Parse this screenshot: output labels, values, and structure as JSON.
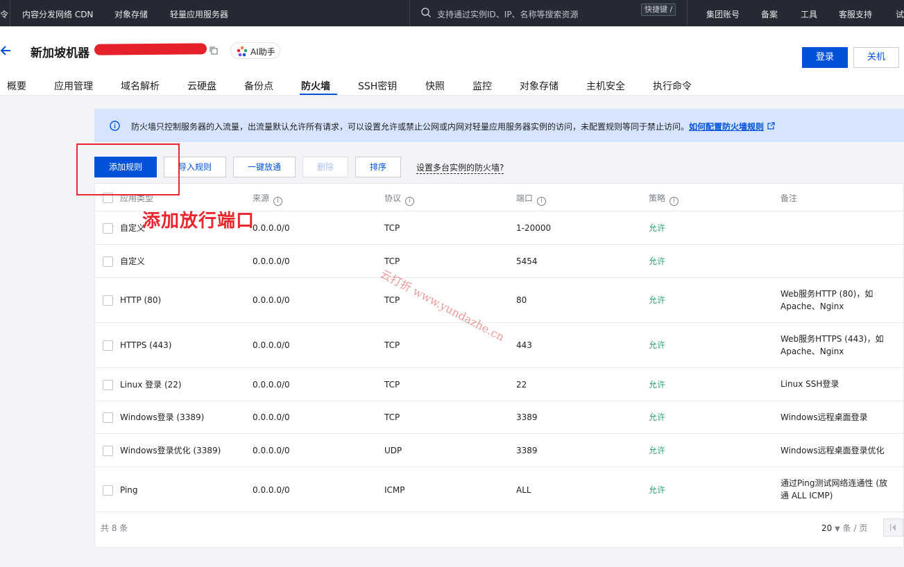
{
  "topnav": {
    "items": [
      "内容分发网络 CDN",
      "对象存储",
      "轻量应用服务器"
    ],
    "search_placeholder": "支持通过实例ID、IP、名称等搜索资源",
    "shortcut": "快捷键 /",
    "right_items": [
      "集团账号",
      "备案",
      "工具",
      "客服支持",
      "试"
    ]
  },
  "header": {
    "title": "新加坡机器",
    "ai_label": "AI助手",
    "login_label": "登录",
    "shutdown_label": "关机",
    "tabs": [
      "概要",
      "应用管理",
      "域名解析",
      "云硬盘",
      "备份点",
      "防火墙",
      "SSH密钥",
      "快照",
      "监控",
      "对象存储",
      "主机安全",
      "执行命令"
    ],
    "active_tab": "防火墙"
  },
  "notice": {
    "text": "防火墙只控制服务器的入流量，出流量默认允许所有请求，可以设置允许或禁止公网或内网对轻量应用服务器实例的访问，未配置规则等同于禁止访问。",
    "link": "如何配置防火墙规则"
  },
  "toolbar": {
    "add_rule": "添加规则",
    "import_rule": "导入规则",
    "allow_all": "一键放通",
    "delete": "删除",
    "sort": "排序",
    "multi_instance_link": "设置多台实例的防火墙?"
  },
  "table": {
    "columns": [
      "应用类型",
      "来源",
      "协议",
      "端口",
      "策略",
      "备注"
    ],
    "rows": [
      {
        "app": "自定义",
        "source": "0.0.0.0/0",
        "protocol": "TCP",
        "port": "1-20000",
        "policy": "允许",
        "note": ""
      },
      {
        "app": "自定义",
        "source": "0.0.0.0/0",
        "protocol": "TCP",
        "port": "5454",
        "policy": "允许",
        "note": ""
      },
      {
        "app": "HTTP (80)",
        "source": "0.0.0.0/0",
        "protocol": "TCP",
        "port": "80",
        "policy": "允许",
        "note": "Web服务HTTP (80)，如 Apache、Nginx"
      },
      {
        "app": "HTTPS (443)",
        "source": "0.0.0.0/0",
        "protocol": "TCP",
        "port": "443",
        "policy": "允许",
        "note": "Web服务HTTPS (443)，如 Apache、Nginx"
      },
      {
        "app": "Linux 登录 (22)",
        "source": "0.0.0.0/0",
        "protocol": "TCP",
        "port": "22",
        "policy": "允许",
        "note": "Linux SSH登录"
      },
      {
        "app": "Windows登录 (3389)",
        "source": "0.0.0.0/0",
        "protocol": "TCP",
        "port": "3389",
        "policy": "允许",
        "note": "Windows远程桌面登录"
      },
      {
        "app": "Windows登录优化 (3389)",
        "source": "0.0.0.0/0",
        "protocol": "UDP",
        "port": "3389",
        "policy": "允许",
        "note": "Windows远程桌面登录优化"
      },
      {
        "app": "Ping",
        "source": "0.0.0.0/0",
        "protocol": "ICMP",
        "port": "ALL",
        "policy": "允许",
        "note": "通过Ping测试网络连通性 (放通 ALL ICMP)"
      }
    ],
    "total": "共 8 条",
    "page_size": "20",
    "page_size_unit": "条 / 页"
  },
  "annotation": {
    "label": "添加放行端口",
    "watermark": "云打折 www.yundazhe.cn"
  },
  "colors": {
    "primary": "#0052d9",
    "allow": "#2ba471",
    "annotation_red": "#e8262d",
    "topnav_bg": "#242933"
  }
}
